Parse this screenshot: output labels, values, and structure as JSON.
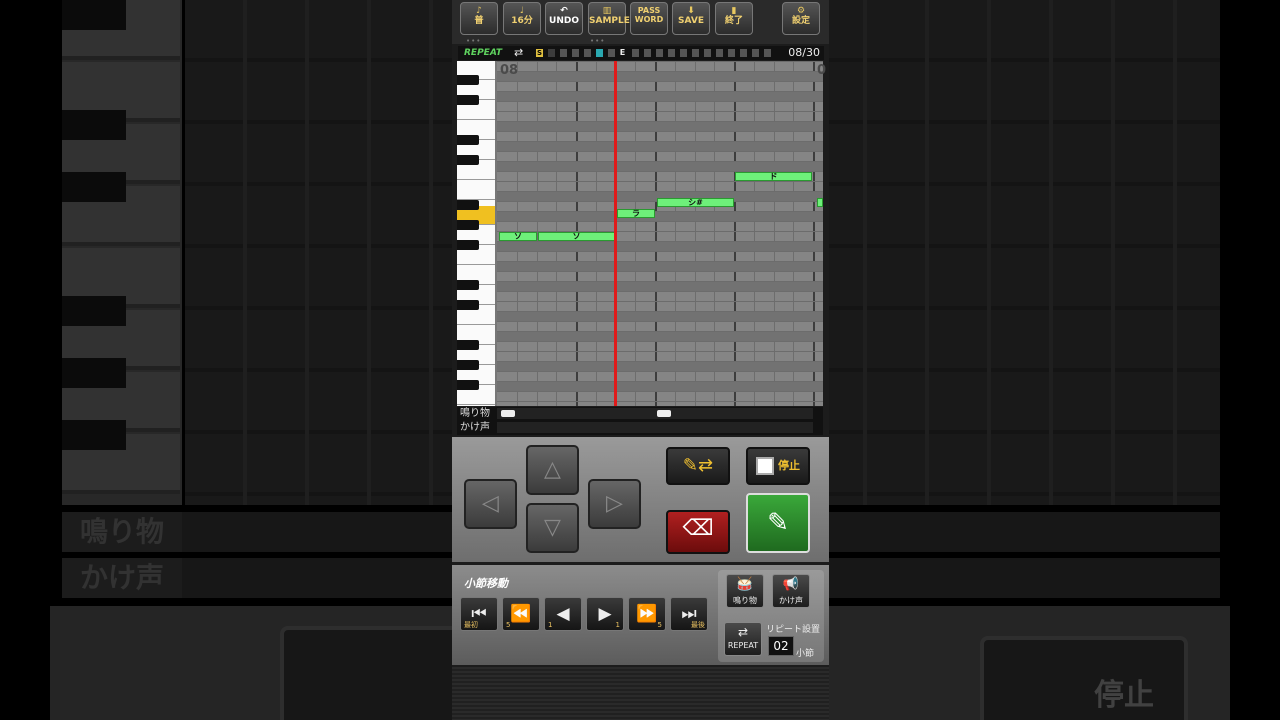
{
  "toolbar": {
    "buttons": [
      {
        "label": "普",
        "name": "instrument-button"
      },
      {
        "label": "16分",
        "name": "note-length-button"
      },
      {
        "label": "UNDO",
        "name": "undo-button"
      },
      {
        "label": "SAMPLE",
        "name": "sample-button"
      },
      {
        "label": "PASS WORD",
        "name": "password-button"
      },
      {
        "label": "SAVE",
        "name": "save-button"
      },
      {
        "label": "終了",
        "name": "exit-button"
      },
      {
        "label": "設定",
        "name": "settings-button"
      }
    ]
  },
  "repeat_bar": {
    "label": "REPEAT",
    "start_marker": "S",
    "end_marker": "E",
    "counter": "08/30"
  },
  "roll": {
    "measure_number": "08",
    "next_measure_partial": "0",
    "notes": [
      {
        "label": "ソ"
      },
      {
        "label": "ソ"
      },
      {
        "label": "ラ"
      },
      {
        "label": "シ#"
      },
      {
        "label": "ド"
      }
    ]
  },
  "lanes": {
    "percussion_label": "鳴り物",
    "voice_label": "かけ声"
  },
  "controls": {
    "stop_label": "停止"
  },
  "measure_nav": {
    "title": "小節移動",
    "first_label": "最初",
    "back5_label": "5",
    "back1_label": "1",
    "fwd1_label": "1",
    "fwd5_label": "5",
    "last_label": "最後",
    "percussion_button": "鳴り物",
    "voice_button": "かけ声",
    "repeat_button": "REPEAT",
    "repeat_setting_label": "リピート設置",
    "repeat_value": "02",
    "repeat_unit": "小節"
  },
  "background": {
    "percussion_label": "鳴り物",
    "voice_label": "かけ声",
    "stop_label": "停止"
  },
  "colors": {
    "note": "#6ef07a",
    "playhead": "#e01a1a",
    "highlight_key": "#f0c020",
    "repeat_label": "#5fd35f"
  }
}
